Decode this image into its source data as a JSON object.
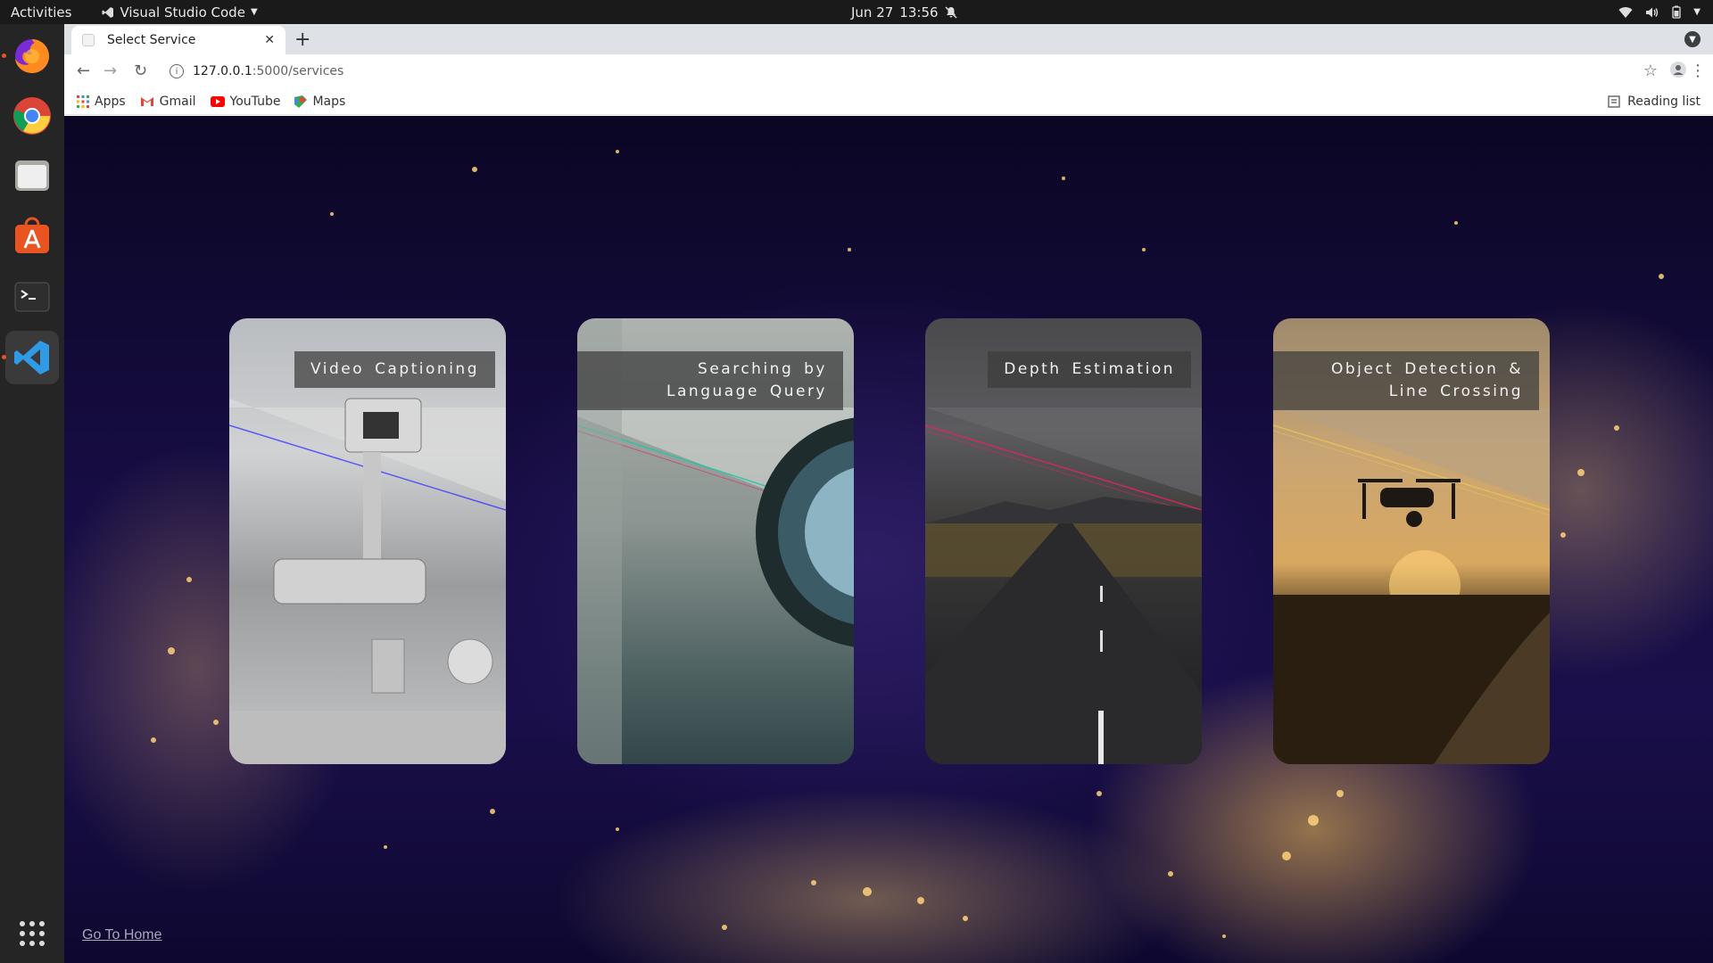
{
  "topbar": {
    "activities": "Activities",
    "app_name": "Visual Studio Code",
    "date": "Jun 27",
    "time": "13:56"
  },
  "dock": {
    "items": [
      "firefox-icon",
      "chrome-icon",
      "files-icon",
      "software-icon",
      "terminal-icon",
      "vscode-icon"
    ],
    "apps_grid": "show-apps-icon"
  },
  "browser": {
    "tab_title": "Select Service",
    "url_host": "127.0.0.1",
    "url_path": ":5000/services",
    "bookmarks": [
      "Apps",
      "Gmail",
      "YouTube",
      "Maps"
    ],
    "reading_list": "Reading list"
  },
  "page": {
    "cards": [
      {
        "label": "Video Captioning",
        "accent": "#3a3aff"
      },
      {
        "label": "Searching by Language Query",
        "accent": "#21c7a8"
      },
      {
        "label": "Depth Estimation",
        "accent": "#e0245e"
      },
      {
        "label": "Object Detection & Line Crossing",
        "accent": "#e3c15a"
      }
    ],
    "home_link": "Go To Home"
  }
}
